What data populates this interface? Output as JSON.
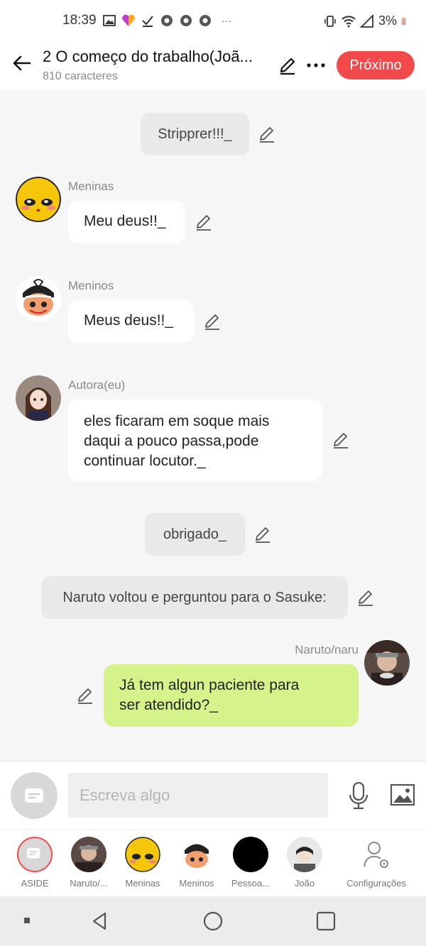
{
  "status": {
    "time": "18:39",
    "battery": "3%",
    "overflow": "···"
  },
  "header": {
    "title": "2 O começo do trabalho(Joã...",
    "subtitle": "810 caracteres",
    "next_label": "Próximo"
  },
  "messages": [
    {
      "kind": "narration",
      "text": "Stripprer!!!_"
    },
    {
      "kind": "left",
      "speaker": "Meninas",
      "text": "Meu deus!!_"
    },
    {
      "kind": "left",
      "speaker": "Meninos",
      "text": "Meus deus!!_"
    },
    {
      "kind": "left",
      "speaker": "Autora(eu)",
      "lines": [
        "eles ficaram em soque mais",
        "daqui a pouco passa,pode",
        "continuar locutor._"
      ]
    },
    {
      "kind": "narration",
      "text": "obrigado_"
    },
    {
      "kind": "narration",
      "text": "Naruto voltou e perguntou para o Sasuke:"
    },
    {
      "kind": "right",
      "speaker": "Naruto/naru",
      "lines": [
        "Já tem algun paciente para",
        "ser atendido?_"
      ]
    }
  ],
  "composer": {
    "placeholder": "Escreva algo"
  },
  "characters": [
    {
      "label": "ASIDE"
    },
    {
      "label": "Naruto/..."
    },
    {
      "label": "Meninas"
    },
    {
      "label": "Meninos"
    },
    {
      "label": "Pessoa..."
    },
    {
      "label": "João"
    },
    {
      "label": "Configurações"
    }
  ],
  "colors": {
    "accent": "#f24a4a",
    "right_bubble": "#d6f28a",
    "narration": "#e9e9e9"
  }
}
